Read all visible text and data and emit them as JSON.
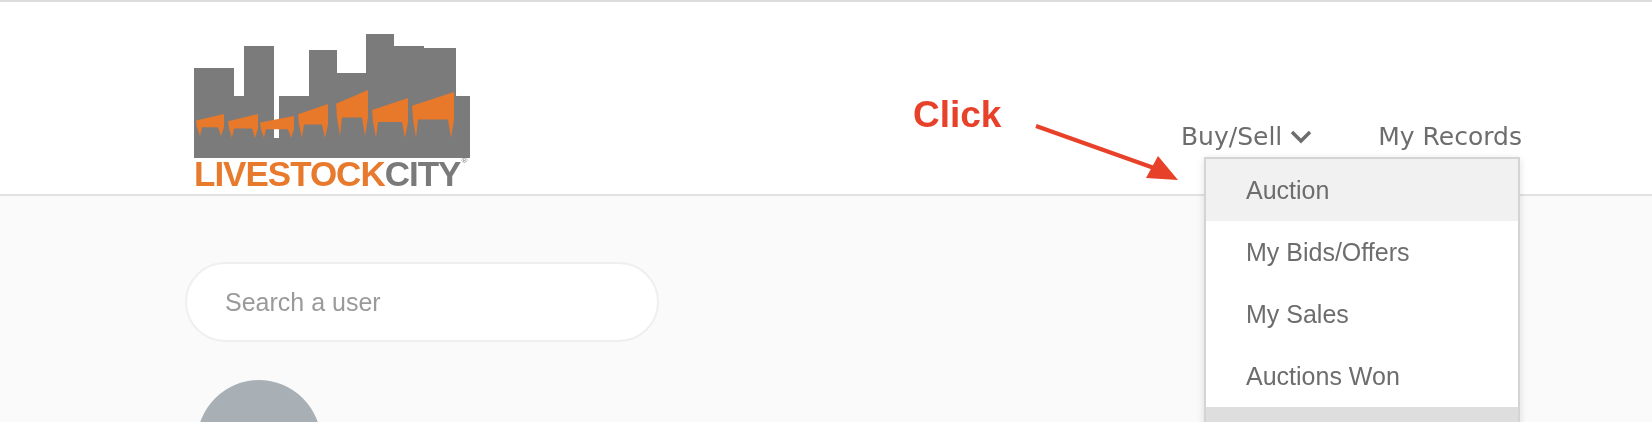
{
  "logo": {
    "word_1": "LIVESTOCK",
    "word_2": "CITY",
    "mark": "®"
  },
  "annotation": {
    "label": "Click"
  },
  "nav": [
    {
      "label": "Buy/Sell",
      "expanded": true
    },
    {
      "label": "My Records"
    }
  ],
  "dropdown": {
    "items": [
      {
        "label": "Auction",
        "selected": true
      },
      {
        "label": "My Bids/Offers",
        "selected": false
      },
      {
        "label": "My Sales",
        "selected": false
      },
      {
        "label": "Auctions Won",
        "selected": false
      },
      {
        "selected": false
      }
    ]
  },
  "search": {
    "placeholder": "Search a user"
  }
}
